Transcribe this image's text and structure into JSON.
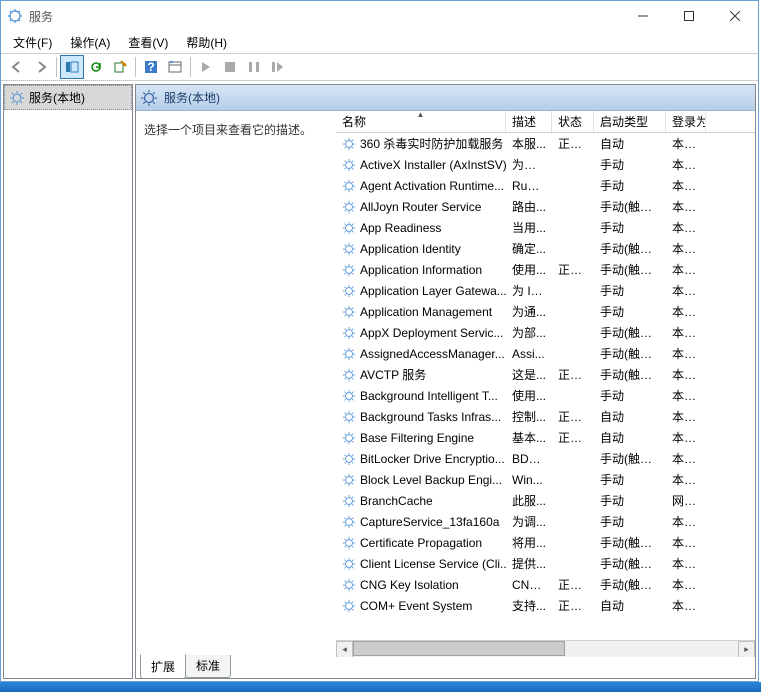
{
  "window": {
    "title": "服务"
  },
  "menu": {
    "file": "文件(F)",
    "action": "操作(A)",
    "view": "查看(V)",
    "help": "帮助(H)"
  },
  "tree": {
    "node": "服务(本地)"
  },
  "pane": {
    "title": "服务(本地)",
    "description": "选择一个项目来查看它的描述。"
  },
  "columns": {
    "name": "名称",
    "desc": "描述",
    "status": "状态",
    "start": "启动类型",
    "logon": "登录为"
  },
  "tabs": {
    "extended": "扩展",
    "standard": "标准"
  },
  "services": [
    {
      "name": "360 杀毒实时防护加载服务",
      "desc": "本服...",
      "status": "正在...",
      "start": "自动",
      "logon": "本地系"
    },
    {
      "name": "ActiveX Installer (AxInstSV)",
      "desc": "为从 ...",
      "status": "",
      "start": "手动",
      "logon": "本地系"
    },
    {
      "name": "Agent Activation Runtime...",
      "desc": "Runt...",
      "status": "",
      "start": "手动",
      "logon": "本地系"
    },
    {
      "name": "AllJoyn Router Service",
      "desc": "路由...",
      "status": "",
      "start": "手动(触发...",
      "logon": "本地服"
    },
    {
      "name": "App Readiness",
      "desc": "当用...",
      "status": "",
      "start": "手动",
      "logon": "本地系"
    },
    {
      "name": "Application Identity",
      "desc": "确定...",
      "status": "",
      "start": "手动(触发...",
      "logon": "本地服"
    },
    {
      "name": "Application Information",
      "desc": "使用...",
      "status": "正在...",
      "start": "手动(触发...",
      "logon": "本地系"
    },
    {
      "name": "Application Layer Gatewa...",
      "desc": "为 In...",
      "status": "",
      "start": "手动",
      "logon": "本地服"
    },
    {
      "name": "Application Management",
      "desc": "为通...",
      "status": "",
      "start": "手动",
      "logon": "本地系"
    },
    {
      "name": "AppX Deployment Servic...",
      "desc": "为部...",
      "status": "",
      "start": "手动(触发...",
      "logon": "本地系"
    },
    {
      "name": "AssignedAccessManager...",
      "desc": "Assi...",
      "status": "",
      "start": "手动(触发...",
      "logon": "本地系"
    },
    {
      "name": "AVCTP 服务",
      "desc": "这是...",
      "status": "正在...",
      "start": "手动(触发...",
      "logon": "本地服"
    },
    {
      "name": "Background Intelligent T...",
      "desc": "使用...",
      "status": "",
      "start": "手动",
      "logon": "本地系"
    },
    {
      "name": "Background Tasks Infras...",
      "desc": "控制...",
      "status": "正在...",
      "start": "自动",
      "logon": "本地系"
    },
    {
      "name": "Base Filtering Engine",
      "desc": "基本...",
      "status": "正在...",
      "start": "自动",
      "logon": "本地服"
    },
    {
      "name": "BitLocker Drive Encryptio...",
      "desc": "BDE...",
      "status": "",
      "start": "手动(触发...",
      "logon": "本地系"
    },
    {
      "name": "Block Level Backup Engi...",
      "desc": "Win...",
      "status": "",
      "start": "手动",
      "logon": "本地系"
    },
    {
      "name": "BranchCache",
      "desc": "此服...",
      "status": "",
      "start": "手动",
      "logon": "网络服"
    },
    {
      "name": "CaptureService_13fa160a",
      "desc": "为调...",
      "status": "",
      "start": "手动",
      "logon": "本地系"
    },
    {
      "name": "Certificate Propagation",
      "desc": "将用...",
      "status": "",
      "start": "手动(触发...",
      "logon": "本地系"
    },
    {
      "name": "Client License Service (Cli...",
      "desc": "提供...",
      "status": "",
      "start": "手动(触发...",
      "logon": "本地系"
    },
    {
      "name": "CNG Key Isolation",
      "desc": "CNG...",
      "status": "正在...",
      "start": "手动(触发...",
      "logon": "本地系"
    },
    {
      "name": "COM+ Event System",
      "desc": "支持...",
      "status": "正在...",
      "start": "自动",
      "logon": "本地服"
    }
  ]
}
